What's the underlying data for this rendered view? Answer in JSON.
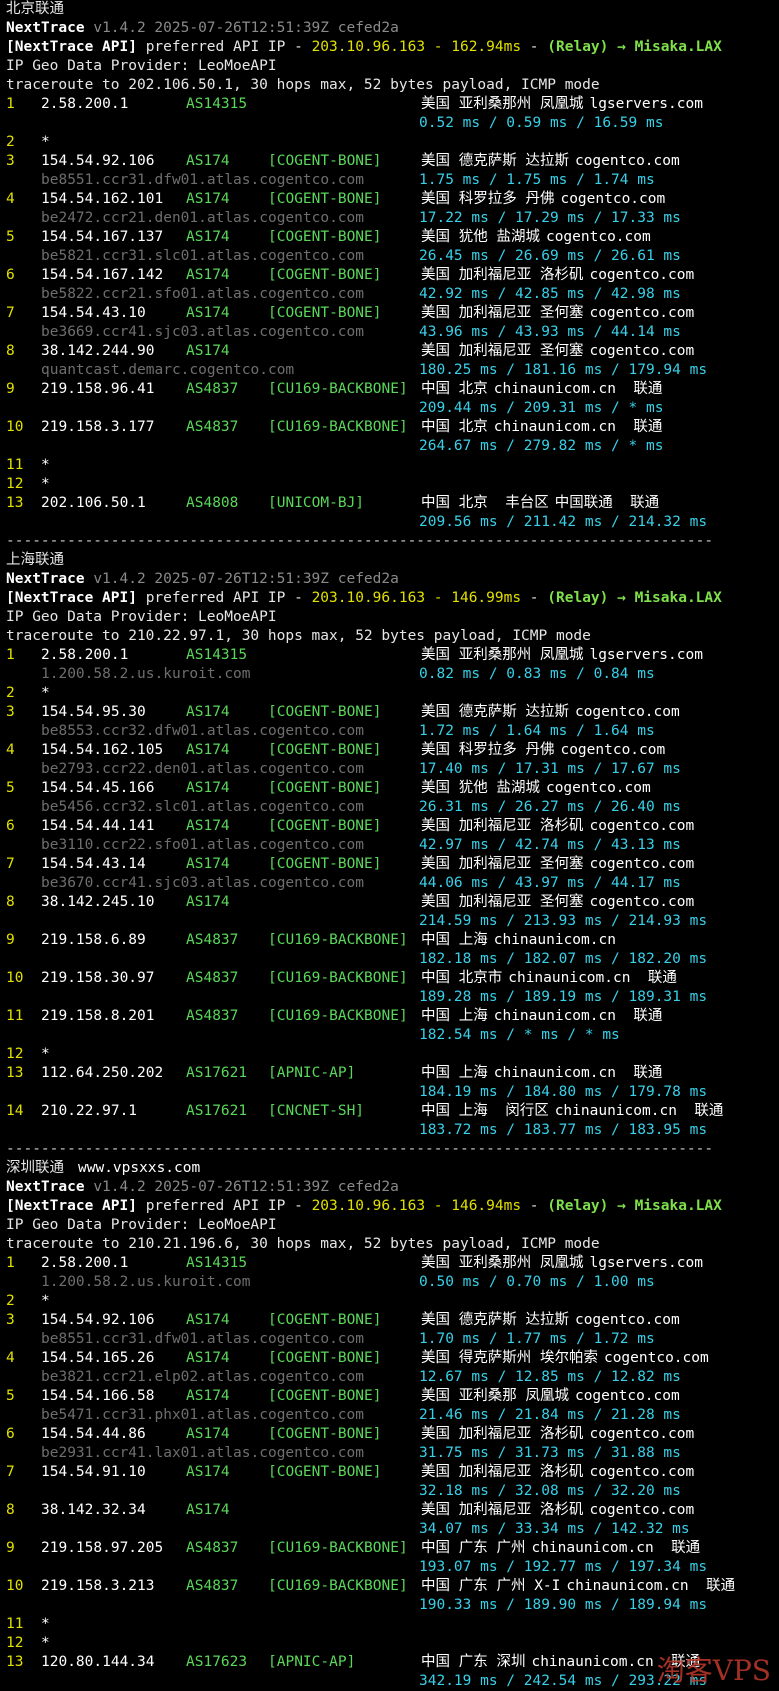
{
  "watermark": "淘客VPS",
  "blocks": [
    {
      "title": "北京联通",
      "site": "",
      "version_line": "v1.4.2 2025-07-26T12:51:39Z cefed2a",
      "api_ip": "203.10.96.163 - 162.94ms",
      "relay": "(Relay) → Misaka.LAX",
      "provider": "IP Geo Data Provider: LeoMoeAPI",
      "trace": "traceroute to 202.106.50.1, 30 hops max, 52 bytes payload, ICMP mode",
      "hops": [
        {
          "no": "1",
          "ip": "2.58.200.1",
          "as": "AS14315",
          "tag": "",
          "loc": "美国 亚利桑那州 凤凰城",
          "dom": "lgservers.com",
          "host": "",
          "rtt": "0.52 ms / 0.59 ms / 16.59 ms"
        },
        {
          "no": "2",
          "ip": "*",
          "as": "",
          "tag": "",
          "loc": "",
          "dom": "",
          "host": "",
          "rtt": ""
        },
        {
          "no": "3",
          "ip": "154.54.92.106",
          "as": "AS174",
          "tag": "[COGENT-BONE]",
          "loc": "美国 德克萨斯 达拉斯",
          "dom": "cogentco.com",
          "host": "be8551.ccr31.dfw01.atlas.cogentco.com",
          "rtt": "1.75 ms / 1.75 ms / 1.74 ms"
        },
        {
          "no": "4",
          "ip": "154.54.162.101",
          "as": "AS174",
          "tag": "[COGENT-BONE]",
          "loc": "美国 科罗拉多 丹佛",
          "dom": "cogentco.com",
          "host": "be2472.ccr21.den01.atlas.cogentco.com",
          "rtt": "17.22 ms / 17.29 ms / 17.33 ms"
        },
        {
          "no": "5",
          "ip": "154.54.167.137",
          "as": "AS174",
          "tag": "[COGENT-BONE]",
          "loc": "美国 犹他 盐湖城",
          "dom": "cogentco.com",
          "host": "be5821.ccr31.slc01.atlas.cogentco.com",
          "rtt": "26.45 ms / 26.69 ms / 26.61 ms"
        },
        {
          "no": "6",
          "ip": "154.54.167.142",
          "as": "AS174",
          "tag": "[COGENT-BONE]",
          "loc": "美国 加利福尼亚 洛杉矶",
          "dom": "cogentco.com",
          "host": "be5822.ccr21.sfo01.atlas.cogentco.com",
          "rtt": "42.92 ms / 42.85 ms / 42.98 ms"
        },
        {
          "no": "7",
          "ip": "154.54.43.10",
          "as": "AS174",
          "tag": "[COGENT-BONE]",
          "loc": "美国 加利福尼亚 圣何塞",
          "dom": "cogentco.com",
          "host": "be3669.ccr41.sjc03.atlas.cogentco.com",
          "rtt": "43.96 ms / 43.93 ms / 44.14 ms"
        },
        {
          "no": "8",
          "ip": "38.142.244.90",
          "as": "AS174",
          "tag": "",
          "loc": "美国 加利福尼亚 圣何塞",
          "dom": "cogentco.com",
          "host": "quantcast.demarc.cogentco.com",
          "rtt": "180.25 ms / 181.16 ms / 179.94 ms"
        },
        {
          "no": "9",
          "ip": "219.158.96.41",
          "as": "AS4837",
          "tag": "[CU169-BACKBONE]",
          "loc": "中国 北京",
          "dom": "chinaunicom.cn  联通",
          "host": "",
          "rtt": "209.44 ms / 209.31 ms / * ms"
        },
        {
          "no": "10",
          "ip": "219.158.3.177",
          "as": "AS4837",
          "tag": "[CU169-BACKBONE]",
          "loc": "中国 北京",
          "dom": "chinaunicom.cn  联通",
          "host": "",
          "rtt": "264.67 ms / 279.82 ms / * ms"
        },
        {
          "no": "11",
          "ip": "*",
          "as": "",
          "tag": "",
          "loc": "",
          "dom": "",
          "host": "",
          "rtt": ""
        },
        {
          "no": "12",
          "ip": "*",
          "as": "",
          "tag": "",
          "loc": "",
          "dom": "",
          "host": "",
          "rtt": ""
        },
        {
          "no": "13",
          "ip": "202.106.50.1",
          "as": "AS4808",
          "tag": "[UNICOM-BJ]",
          "loc": "中国 北京  丰台区",
          "dom": "中国联通  联通",
          "host": "",
          "rtt": "209.56 ms / 211.42 ms / 214.32 ms"
        }
      ]
    },
    {
      "title": "上海联通",
      "site": "",
      "version_line": "v1.4.2 2025-07-26T12:51:39Z cefed2a",
      "api_ip": "203.10.96.163 - 146.99ms",
      "relay": "(Relay) → Misaka.LAX",
      "provider": "IP Geo Data Provider: LeoMoeAPI",
      "trace": "traceroute to 210.22.97.1, 30 hops max, 52 bytes payload, ICMP mode",
      "hops": [
        {
          "no": "1",
          "ip": "2.58.200.1",
          "as": "AS14315",
          "tag": "",
          "loc": "美国 亚利桑那州 凤凰城",
          "dom": "lgservers.com",
          "host": "1.200.58.2.us.kuroit.com",
          "rtt": "0.82 ms / 0.83 ms / 0.84 ms"
        },
        {
          "no": "2",
          "ip": "*",
          "as": "",
          "tag": "",
          "loc": "",
          "dom": "",
          "host": "",
          "rtt": ""
        },
        {
          "no": "3",
          "ip": "154.54.95.30",
          "as": "AS174",
          "tag": "[COGENT-BONE]",
          "loc": "美国 德克萨斯 达拉斯",
          "dom": "cogentco.com",
          "host": "be8553.ccr32.dfw01.atlas.cogentco.com",
          "rtt": "1.72 ms / 1.64 ms / 1.64 ms"
        },
        {
          "no": "4",
          "ip": "154.54.162.105",
          "as": "AS174",
          "tag": "[COGENT-BONE]",
          "loc": "美国 科罗拉多 丹佛",
          "dom": "cogentco.com",
          "host": "be2793.ccr22.den01.atlas.cogentco.com",
          "rtt": "17.40 ms / 17.31 ms / 17.67 ms"
        },
        {
          "no": "5",
          "ip": "154.54.45.166",
          "as": "AS174",
          "tag": "[COGENT-BONE]",
          "loc": "美国 犹他 盐湖城",
          "dom": "cogentco.com",
          "host": "be5456.ccr32.slc01.atlas.cogentco.com",
          "rtt": "26.31 ms / 26.27 ms / 26.40 ms"
        },
        {
          "no": "6",
          "ip": "154.54.44.141",
          "as": "AS174",
          "tag": "[COGENT-BONE]",
          "loc": "美国 加利福尼亚 洛杉矶",
          "dom": "cogentco.com",
          "host": "be3110.ccr22.sfo01.atlas.cogentco.com",
          "rtt": "42.97 ms / 42.74 ms / 43.13 ms"
        },
        {
          "no": "7",
          "ip": "154.54.43.14",
          "as": "AS174",
          "tag": "[COGENT-BONE]",
          "loc": "美国 加利福尼亚 圣何塞",
          "dom": "cogentco.com",
          "host": "be3670.ccr41.sjc03.atlas.cogentco.com",
          "rtt": "44.06 ms / 43.97 ms / 44.17 ms"
        },
        {
          "no": "8",
          "ip": "38.142.245.10",
          "as": "AS174",
          "tag": "",
          "loc": "美国 加利福尼亚 圣何塞",
          "dom": "cogentco.com",
          "host": "",
          "rtt": "214.59 ms / 213.93 ms / 214.93 ms"
        },
        {
          "no": "9",
          "ip": "219.158.6.89",
          "as": "AS4837",
          "tag": "[CU169-BACKBONE]",
          "loc": "中国 上海",
          "dom": "chinaunicom.cn",
          "host": "",
          "rtt": "182.18 ms / 182.07 ms / 182.20 ms"
        },
        {
          "no": "10",
          "ip": "219.158.30.97",
          "as": "AS4837",
          "tag": "[CU169-BACKBONE]",
          "loc": "中国 北京市",
          "dom": "chinaunicom.cn  联通",
          "host": "",
          "rtt": "189.28 ms / 189.19 ms / 189.31 ms"
        },
        {
          "no": "11",
          "ip": "219.158.8.201",
          "as": "AS4837",
          "tag": "[CU169-BACKBONE]",
          "loc": "中国 上海",
          "dom": "chinaunicom.cn  联通",
          "host": "",
          "rtt": "182.54 ms / * ms / * ms"
        },
        {
          "no": "12",
          "ip": "*",
          "as": "",
          "tag": "",
          "loc": "",
          "dom": "",
          "host": "",
          "rtt": ""
        },
        {
          "no": "13",
          "ip": "112.64.250.202",
          "as": "AS17621",
          "tag": "[APNIC-AP]",
          "loc": "中国 上海",
          "dom": "chinaunicom.cn  联通",
          "host": "",
          "rtt": "184.19 ms / 184.80 ms / 179.78 ms"
        },
        {
          "no": "14",
          "ip": "210.22.97.1",
          "as": "AS17621",
          "tag": "[CNCNET-SH]",
          "loc": "中国 上海  闵行区",
          "dom": "chinaunicom.cn  联通",
          "host": "",
          "rtt": "183.72 ms / 183.77 ms / 183.95 ms"
        }
      ]
    },
    {
      "title": "深圳联通",
      "site": "www.vpsxxs.com",
      "version_line": "v1.4.2 2025-07-26T12:51:39Z cefed2a",
      "api_ip": "203.10.96.163 - 146.94ms",
      "relay": "(Relay) → Misaka.LAX",
      "provider": "IP Geo Data Provider: LeoMoeAPI",
      "trace": "traceroute to 210.21.196.6, 30 hops max, 52 bytes payload, ICMP mode",
      "hops": [
        {
          "no": "1",
          "ip": "2.58.200.1",
          "as": "AS14315",
          "tag": "",
          "loc": "美国 亚利桑那州 凤凰城",
          "dom": "lgservers.com",
          "host": "1.200.58.2.us.kuroit.com",
          "rtt": "0.50 ms / 0.70 ms / 1.00 ms"
        },
        {
          "no": "2",
          "ip": "*",
          "as": "",
          "tag": "",
          "loc": "",
          "dom": "",
          "host": "",
          "rtt": ""
        },
        {
          "no": "3",
          "ip": "154.54.92.106",
          "as": "AS174",
          "tag": "[COGENT-BONE]",
          "loc": "美国 德克萨斯 达拉斯",
          "dom": "cogentco.com",
          "host": "be8551.ccr31.dfw01.atlas.cogentco.com",
          "rtt": "1.70 ms / 1.77 ms / 1.72 ms"
        },
        {
          "no": "4",
          "ip": "154.54.165.26",
          "as": "AS174",
          "tag": "[COGENT-BONE]",
          "loc": "美国 得克萨斯州 埃尔帕索",
          "dom": "cogentco.com",
          "host": "be3821.ccr21.elp02.atlas.cogentco.com",
          "rtt": "12.67 ms / 12.85 ms / 12.82 ms"
        },
        {
          "no": "5",
          "ip": "154.54.166.58",
          "as": "AS174",
          "tag": "[COGENT-BONE]",
          "loc": "美国 亚利桑那 凤凰城",
          "dom": "cogentco.com",
          "host": "be5471.ccr31.phx01.atlas.cogentco.com",
          "rtt": "21.46 ms / 21.84 ms / 21.28 ms"
        },
        {
          "no": "6",
          "ip": "154.54.44.86",
          "as": "AS174",
          "tag": "[COGENT-BONE]",
          "loc": "美国 加利福尼亚 洛杉矶",
          "dom": "cogentco.com",
          "host": "be2931.ccr41.lax01.atlas.cogentco.com",
          "rtt": "31.75 ms / 31.73 ms / 31.88 ms"
        },
        {
          "no": "7",
          "ip": "154.54.91.10",
          "as": "AS174",
          "tag": "[COGENT-BONE]",
          "loc": "美国 加利福尼亚 洛杉矶",
          "dom": "cogentco.com",
          "host": "",
          "rtt": "32.18 ms / 32.08 ms / 32.20 ms"
        },
        {
          "no": "8",
          "ip": "38.142.32.34",
          "as": "AS174",
          "tag": "",
          "loc": "美国 加利福尼亚 洛杉矶",
          "dom": "cogentco.com",
          "host": "",
          "rtt": "34.07 ms / 33.34 ms / 142.32 ms"
        },
        {
          "no": "9",
          "ip": "219.158.97.205",
          "as": "AS4837",
          "tag": "[CU169-BACKBONE]",
          "loc": "中国 广东 广州",
          "dom": "chinaunicom.cn  联通",
          "host": "",
          "rtt": "193.07 ms / 192.77 ms / 197.34 ms"
        },
        {
          "no": "10",
          "ip": "219.158.3.213",
          "as": "AS4837",
          "tag": "[CU169-BACKBONE]",
          "loc": "中国 广东 广州 X-I",
          "dom": "chinaunicom.cn  联通",
          "host": "",
          "rtt": "190.33 ms / 189.90 ms / 189.94 ms"
        },
        {
          "no": "11",
          "ip": "*",
          "as": "",
          "tag": "",
          "loc": "",
          "dom": "",
          "host": "",
          "rtt": ""
        },
        {
          "no": "12",
          "ip": "*",
          "as": "",
          "tag": "",
          "loc": "",
          "dom": "",
          "host": "",
          "rtt": ""
        },
        {
          "no": "13",
          "ip": "120.80.144.34",
          "as": "AS17623",
          "tag": "[APNIC-AP]",
          "loc": "中国 广东 深圳",
          "dom": "chinaunicom.cn  联通",
          "host": "",
          "rtt": "342.19 ms / 242.54 ms / 293.22 ms"
        }
      ]
    }
  ],
  "labels": {
    "nexttrace": "NextTrace",
    "api_prefix": "[NextTrace API]",
    "api_text": "preferred API IP - ",
    "separator": "---------------------------------------------------------------------------------"
  }
}
